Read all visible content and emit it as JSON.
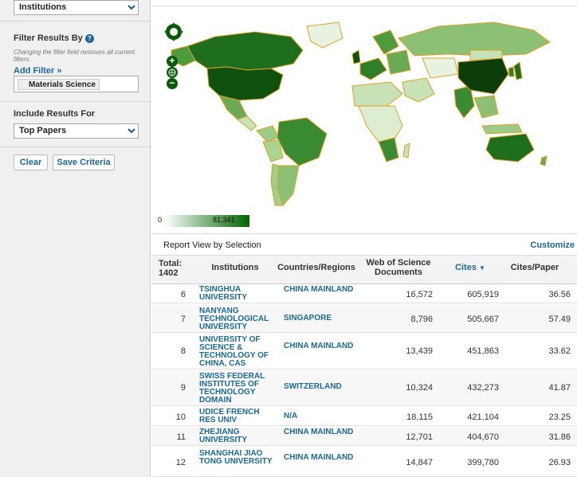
{
  "sidebar": {
    "top_select": {
      "value": "Institutions"
    },
    "filter_title": "Filter Results By",
    "filter_hint": "Changing the filter field removes all current filters.",
    "add_filter": "Add Filter »",
    "filter_chip": "Materials Science",
    "include_title": "Include Results For",
    "include_select": {
      "value": "Top Papers"
    },
    "clear_label": "Clear",
    "save_label": "Save Criteria"
  },
  "map": {
    "legend_min": "0",
    "legend_max": "81,341",
    "colors": {
      "low": "#ffffff",
      "high": "#006400",
      "border": "#e0a020",
      "nav": "#0a5a0a"
    }
  },
  "report": {
    "title": "Report View by Selection",
    "customize": "Customize",
    "columns": {
      "total_label": "Total:",
      "total_value": "1402",
      "institutions": "Institutions",
      "countries": "Countries/Regions",
      "wos": "Web of Science Documents",
      "cites": "Cites",
      "cites_per_paper": "Cites/Paper"
    },
    "rows": [
      {
        "rank": "6",
        "institution": "TSINGHUA UNIVERSITY",
        "country": "CHINA MAINLAND",
        "wos": "16,572",
        "cites": "605,919",
        "cpp": "36.56"
      },
      {
        "rank": "7",
        "institution": "NANYANG TECHNOLOGICAL UNIVERSITY",
        "country": "SINGAPORE",
        "wos": "8,796",
        "cites": "505,667",
        "cpp": "57.49"
      },
      {
        "rank": "8",
        "institution": "UNIVERSITY OF SCIENCE & TECHNOLOGY OF CHINA, CAS",
        "country": "CHINA MAINLAND",
        "wos": "13,439",
        "cites": "451,863",
        "cpp": "33.62"
      },
      {
        "rank": "9",
        "institution": "SWISS FEDERAL INSTITUTES OF TECHNOLOGY DOMAIN",
        "country": "SWITZERLAND",
        "wos": "10,324",
        "cites": "432,273",
        "cpp": "41.87"
      },
      {
        "rank": "10",
        "institution": "UDICE FRENCH RES UNIV",
        "country": "N/A",
        "wos": "18,115",
        "cites": "421,104",
        "cpp": "23.25"
      },
      {
        "rank": "11",
        "institution": "ZHEJIANG UNIVERSITY",
        "country": "CHINA MAINLAND",
        "wos": "12,701",
        "cites": "404,670",
        "cpp": "31.86"
      },
      {
        "rank": "12",
        "institution": "SHANGHAI JIAO TONG UNIVERSITY",
        "country": "CHINA MAINLAND",
        "wos": "14,847",
        "cites": "399,780",
        "cpp": "26.93"
      }
    ]
  }
}
